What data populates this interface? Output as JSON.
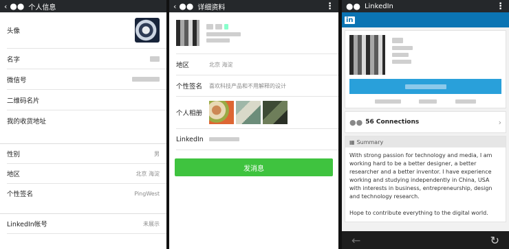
{
  "panel1": {
    "title": "个人信息",
    "rows_a": [
      {
        "label": "头像"
      },
      {
        "label": "名字"
      },
      {
        "label": "微信号"
      },
      {
        "label": "二维码名片"
      },
      {
        "label": "我的收货地址"
      }
    ],
    "rows_b": [
      {
        "label": "性别",
        "value": "男"
      },
      {
        "label": "地区",
        "value": "北京 海淀"
      },
      {
        "label": "个性签名",
        "value": "PingWest"
      }
    ],
    "linkedin": {
      "label": "LinkedIn帐号",
      "value": "未展示"
    }
  },
  "panel2": {
    "title": "详细资料",
    "region": {
      "label": "地区",
      "value": "北京 海淀"
    },
    "signature": {
      "label": "个性签名",
      "value": "喜欢科技产品和不用解释的设计"
    },
    "album": {
      "label": "个人相册"
    },
    "linkedin": {
      "label": "LinkedIn"
    },
    "send_button": "发消息"
  },
  "panel3": {
    "title": "LinkedIn",
    "badge": "in",
    "connections": "56 Connections",
    "summary_header": "Summary",
    "summary_p1": "With strong passion for technology and media, I am working hard to be a better designer, a better researcher and a better inventor. I have experience working and studying independently in China, USA with interests in business, entrepreneurship, design and technology research.",
    "summary_p2": "Hope to contribute everything to the digital world."
  },
  "colors": {
    "wechat_green": "#3fc33f",
    "linkedin_blue": "#0b74b3",
    "dark_bar": "#25282b"
  }
}
